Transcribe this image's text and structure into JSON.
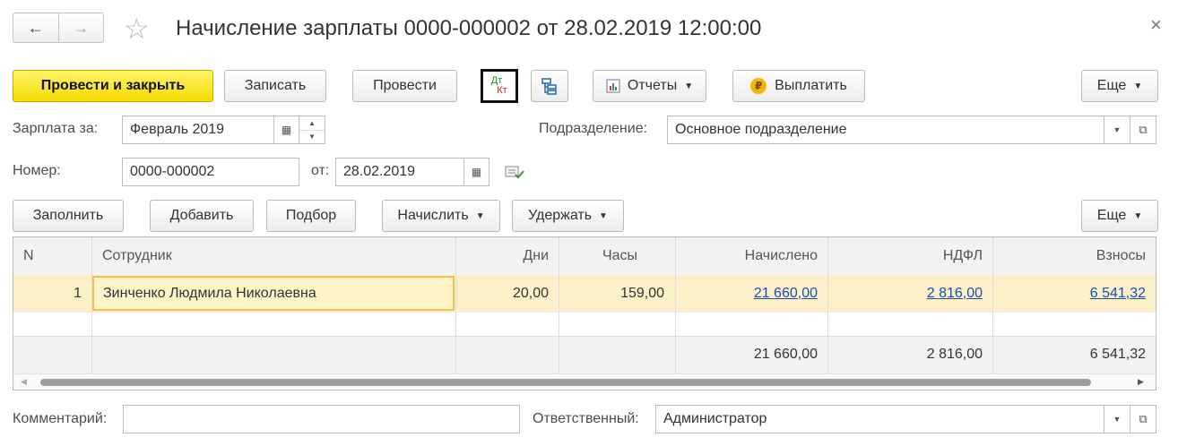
{
  "window": {
    "title": "Начисление зарплаты 0000-000002 от 28.02.2019 12:00:00",
    "close_glyph": "×",
    "nav_back_glyph": "←",
    "nav_forward_glyph": "→",
    "favorite_glyph": "☆"
  },
  "toolbar": {
    "post_close": "Провести и закрыть",
    "save": "Записать",
    "post": "Провести",
    "dt_label": "Дт",
    "kt_label": "Кт",
    "reports": "Отчеты",
    "pay": "Выплатить",
    "more": "Еще"
  },
  "form": {
    "salary_for_label": "Зарплата за:",
    "salary_for_value": "Февраль 2019",
    "department_label": "Подразделение:",
    "department_value": "Основное подразделение",
    "number_label": "Номер:",
    "number_value": "0000-000002",
    "date_label": "от:",
    "date_value": "28.02.2019"
  },
  "table_toolbar": {
    "fill": "Заполнить",
    "add": "Добавить",
    "select": "Подбор",
    "accrue": "Начислить",
    "withhold": "Удержать",
    "more": "Еще"
  },
  "table": {
    "columns": [
      "N",
      "Сотрудник",
      "Дни",
      "Часы",
      "Начислено",
      "НДФЛ",
      "Взносы"
    ],
    "rows": [
      {
        "n": "1",
        "employee": "Зинченко Людмила Николаевна",
        "days": "20,00",
        "hours": "159,00",
        "accrued": "21 660,00",
        "ndfl": "2 816,00",
        "contributions": "6 541,32"
      }
    ],
    "totals": {
      "accrued": "21 660,00",
      "ndfl": "2 816,00",
      "contributions": "6 541,32"
    }
  },
  "footer": {
    "comment_label": "Комментарий:",
    "comment_value": "",
    "responsible_label": "Ответственный:",
    "responsible_value": "Администратор"
  },
  "colors": {
    "primary_button": "#f6dc00",
    "selected_row": "#fbf0c8",
    "selected_cell_border": "#f0c24a",
    "link": "#1a4fb3",
    "header_bg": "#f2f2f2"
  }
}
